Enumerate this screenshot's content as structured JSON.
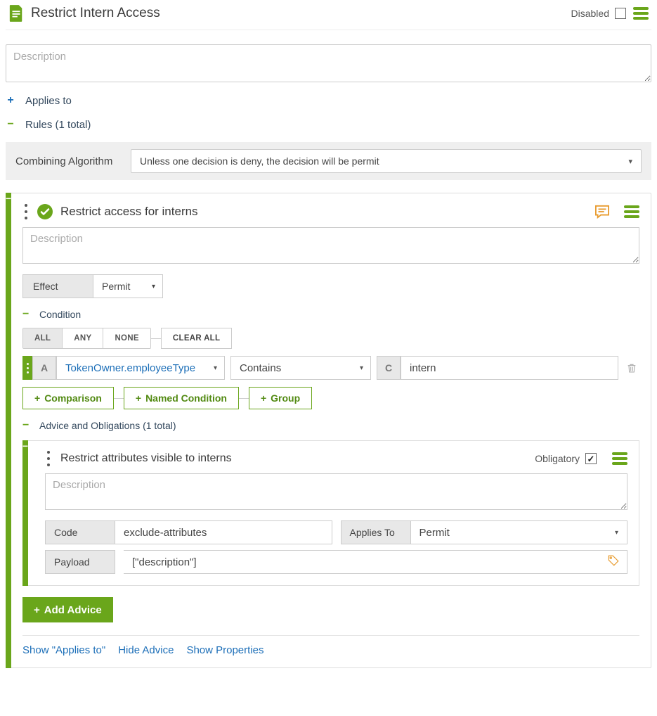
{
  "header": {
    "title": "Restrict Intern Access",
    "disabled_label": "Disabled",
    "disabled_checked": false
  },
  "top_description_placeholder": "Description",
  "applies_to_label": "Applies to",
  "rules_section_label": "Rules (1 total)",
  "combining": {
    "label": "Combining Algorithm",
    "value": "Unless one decision is deny, the decision will be permit"
  },
  "rule": {
    "title": "Restrict access for interns",
    "description_placeholder": "Description",
    "effect_label": "Effect",
    "effect_value": "Permit",
    "condition_label": "Condition",
    "condition_toggle": {
      "all": "ALL",
      "any": "ANY",
      "none": "NONE",
      "active": "ALL"
    },
    "clear_all_label": "CLEAR ALL",
    "condition_row": {
      "a_badge": "A",
      "attribute": "TokenOwner.employeeType",
      "operator": "Contains",
      "c_badge": "C",
      "value": "intern"
    },
    "add_buttons": {
      "comparison": "Comparison",
      "named_condition": "Named Condition",
      "group": "Group"
    },
    "advice_section_label": "Advice and Obligations (1 total)",
    "advice": {
      "title": "Restrict attributes visible to interns",
      "obligatory_label": "Obligatory",
      "obligatory_checked": true,
      "description_placeholder": "Description",
      "code_label": "Code",
      "code_value": "exclude-attributes",
      "applies_to_label": "Applies To",
      "applies_to_value": "Permit",
      "payload_label": "Payload",
      "payload_value": "[\"description\"]"
    },
    "add_advice_label": "Add Advice",
    "footer_links": {
      "show_applies": "Show \"Applies to\"",
      "hide_advice": "Hide Advice",
      "show_properties": "Show Properties"
    }
  }
}
